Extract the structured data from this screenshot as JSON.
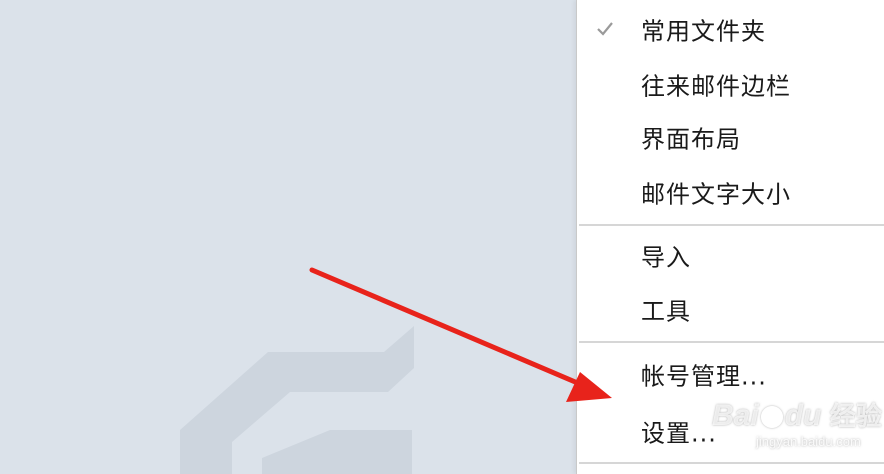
{
  "menu": {
    "groups": [
      {
        "items": [
          {
            "label": "常用文件夹",
            "checked": true
          },
          {
            "label": "往来邮件边栏",
            "checked": false
          },
          {
            "label": "界面布局",
            "checked": false
          },
          {
            "label": "邮件文字大小",
            "checked": false
          }
        ]
      },
      {
        "items": [
          {
            "label": "导入",
            "checked": false
          },
          {
            "label": "工具",
            "checked": false
          }
        ]
      },
      {
        "items": [
          {
            "label": "帐号管理...",
            "checked": false
          },
          {
            "label": "设置...",
            "checked": false
          }
        ]
      }
    ]
  },
  "watermark": {
    "brand_left": "Bai",
    "brand_right": "du",
    "brand_cn": "经验",
    "url": "jingyan.baidu.com"
  },
  "colors": {
    "background": "#dbe2ea",
    "arrow": "#e8231b",
    "menu_bg": "#ffffff"
  },
  "icons": {
    "check": "check-icon",
    "arrow": "red-arrow-annotation",
    "logo_shape": "app-logo-watermark"
  }
}
